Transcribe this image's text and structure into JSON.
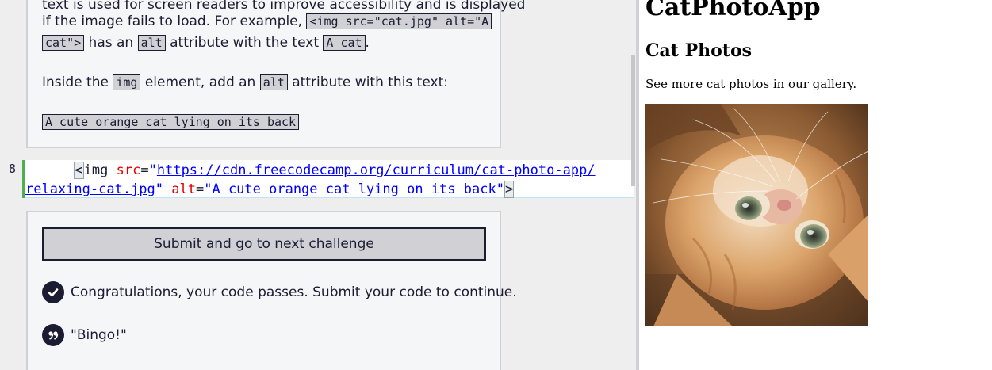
{
  "instructions": {
    "line_partial": "text is used for screen readers to improve accessibility and is displayed",
    "line2_prefix": "if the image fails to load. For example, ",
    "example_code_a": "<img src=\"cat.jpg\" alt=\"A",
    "example_code_b": "cat\">",
    "line3_has_an": " has an ",
    "alt_chip": "alt",
    "line3_attr_text": " attribute with the text ",
    "a_cat_chip": "A cat",
    "line3_end": ".",
    "para2_prefix": "Inside the ",
    "img_chip": "img",
    "para2_mid": " element, add an ",
    "para2_suffix": " attribute with this text:",
    "target_text": "A cute orange cat lying on its back"
  },
  "editor": {
    "line_number": "8",
    "indent": "      ",
    "open_bracket": "<",
    "tag_name": "img",
    "space": " ",
    "src_attr": "src",
    "equals": "=",
    "quote": "\"",
    "url_part1": "https://cdn.freecodecamp.org/curriculum/cat-photo-app/",
    "url_part2": "relaxing-cat.jpg",
    "alt_attr": "alt",
    "alt_value": "\"A cute orange cat lying on its back\"",
    "close_bracket": ">"
  },
  "actions": {
    "submit_label": "Submit and go to next challenge",
    "pass_message": "Congratulations, your code passes. Submit your code to continue.",
    "quote_message": "\"Bingo!\""
  },
  "preview": {
    "title": "CatPhotoApp",
    "subtitle": "Cat Photos",
    "paragraph": "See more cat photos in our gallery."
  },
  "icons": {
    "pass": "check-circle-icon",
    "quote": "quote-icon"
  },
  "colors": {
    "dark": "#1b1b32",
    "panel": "#f5f6f7",
    "green_marker": "#4caf50",
    "attr_red": "#e50000",
    "string_blue": "#0000ff"
  }
}
